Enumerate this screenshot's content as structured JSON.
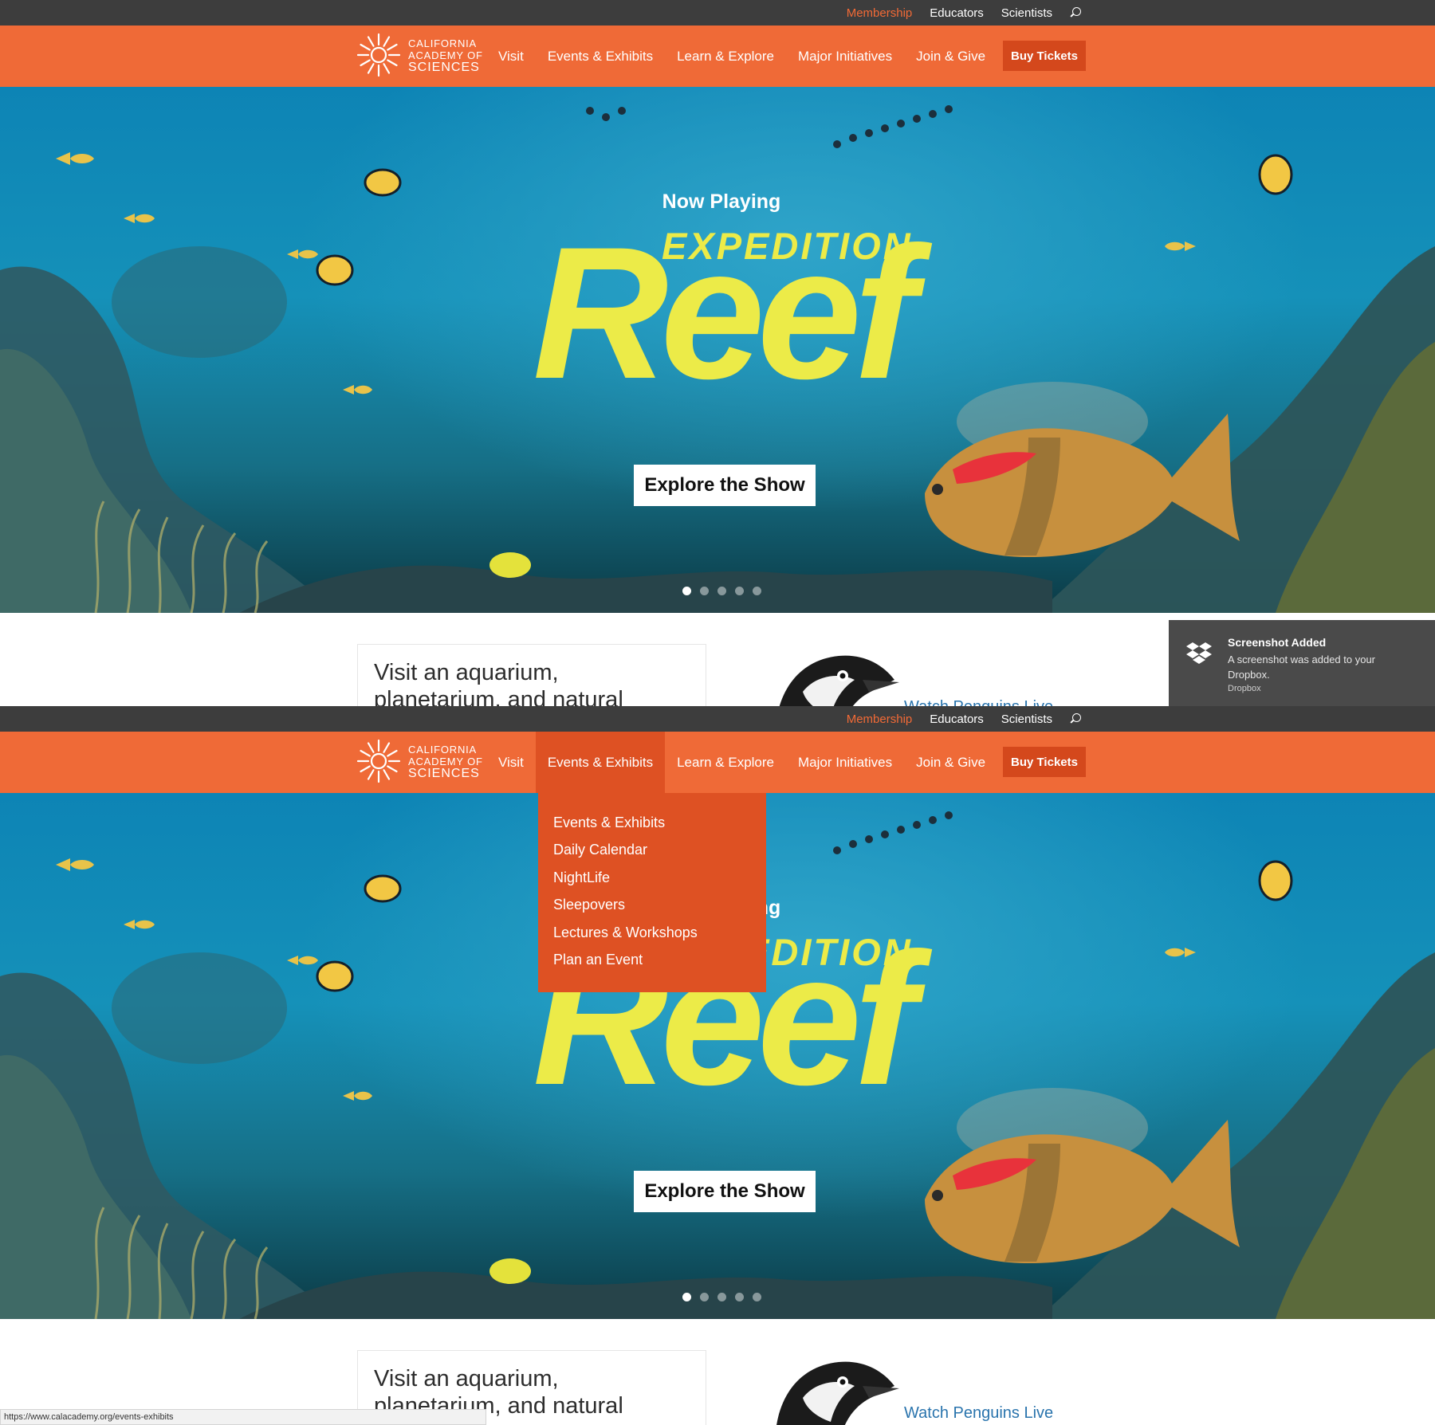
{
  "utility": {
    "membership": "Membership",
    "educators": "Educators",
    "scientists": "Scientists"
  },
  "logo": {
    "line1": "CALIFORNIA",
    "line2": "ACADEMY OF",
    "line3": "SCIENCES"
  },
  "nav": {
    "items": [
      "Visit",
      "Events & Exhibits",
      "Learn & Explore",
      "Major Initiatives",
      "Join & Give"
    ],
    "buy_tickets": "Buy Tickets"
  },
  "hero": {
    "kicker": "Now Playing",
    "title_top": "EXPEDITION",
    "title_main": "Reef",
    "cta": "Explore the Show",
    "slides_total": 5,
    "slide_active": 1
  },
  "intro": {
    "text": "Visit an aquarium, planetarium, and natural history museum—"
  },
  "penguins": {
    "link": "Watch Penguins Live"
  },
  "toast": {
    "title": "Screenshot Added",
    "body": "A screenshot was added to your Dropbox.",
    "source": "Dropbox"
  },
  "dropdown": {
    "items": [
      "Events & Exhibits",
      "Daily Calendar",
      "NightLife",
      "Sleepovers",
      "Lectures & Workshops",
      "Plan an Event"
    ]
  },
  "status": {
    "url": "https://www.calacademy.org/events-exhibits"
  },
  "colors": {
    "nav_orange": "#ef6a37",
    "dropdown_orange": "#de5123",
    "utility_dark": "#3d3d3d",
    "title_yellow": "#eceb48",
    "link_blue": "#2a74ad"
  }
}
